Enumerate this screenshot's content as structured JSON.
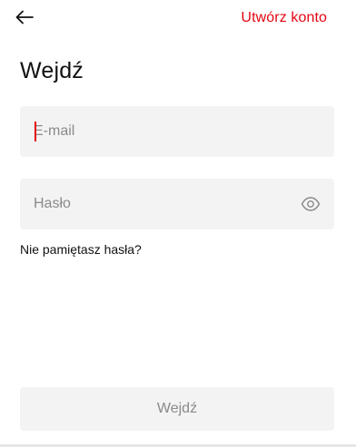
{
  "header": {
    "back_icon": "arrow-left-icon",
    "create_account_label": "Utwórz konto"
  },
  "title": "Wejdź",
  "form": {
    "email": {
      "value": "",
      "placeholder": "E-mail"
    },
    "password": {
      "value": "",
      "placeholder": "Hasło",
      "toggle_icon": "eye-icon"
    },
    "forgot_password_label": "Nie pamiętasz hasła?",
    "submit_label": "Wejdź"
  },
  "colors": {
    "accent": "#e30613",
    "field_background": "#f3f3f3",
    "placeholder": "#8a8a8a",
    "text": "#111111"
  }
}
